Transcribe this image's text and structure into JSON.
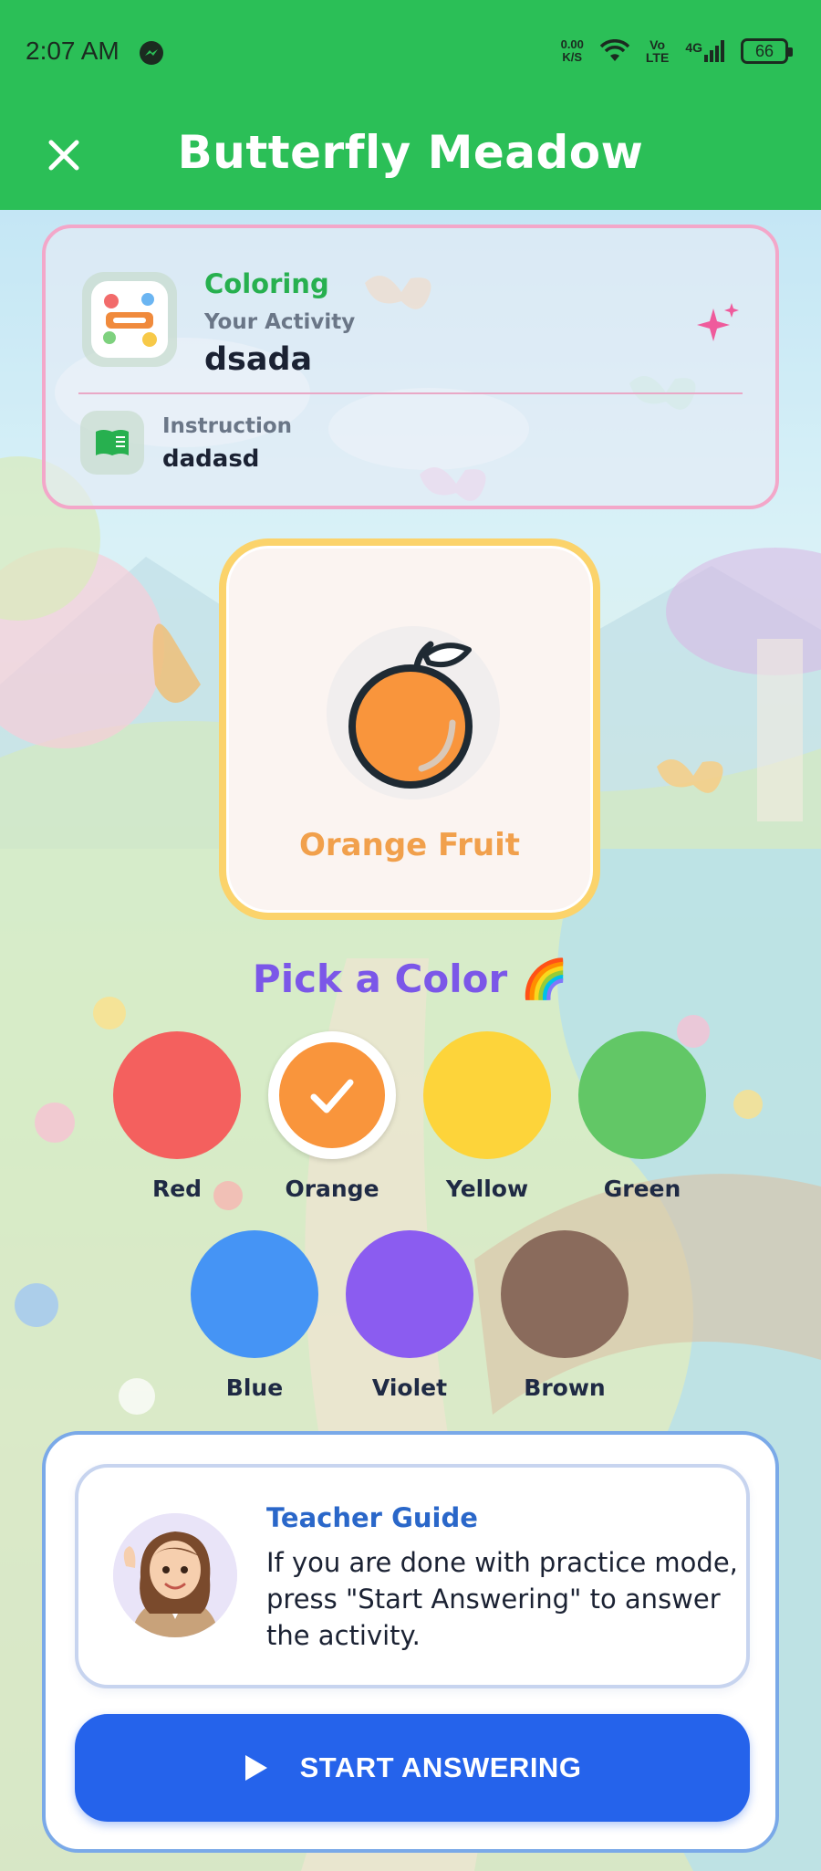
{
  "status_bar": {
    "time": "2:07 AM",
    "net_speed_value": "0.00",
    "net_speed_unit": "K/S",
    "volte_top": "Vo",
    "volte_bottom": "LTE",
    "network": "4G",
    "battery": "66"
  },
  "header": {
    "title": "Butterfly Meadow",
    "background_color": "#2bbf57"
  },
  "activity": {
    "type": "Coloring",
    "label": "Your Activity",
    "name": "dsada",
    "instruction_label": "Instruction",
    "instruction": "dadasd"
  },
  "object": {
    "name": "Orange Fruit"
  },
  "color_picker": {
    "title": "Pick a Color 🌈",
    "selected": "Orange",
    "colors": [
      {
        "name": "Red",
        "hex": "#f4605e"
      },
      {
        "name": "Orange",
        "hex": "#f9953c"
      },
      {
        "name": "Yellow",
        "hex": "#fdd43a"
      },
      {
        "name": "Green",
        "hex": "#62c766"
      },
      {
        "name": "Blue",
        "hex": "#4594f5"
      },
      {
        "name": "Violet",
        "hex": "#8b5cf0"
      },
      {
        "name": "Brown",
        "hex": "#8a6b5c"
      }
    ]
  },
  "teacher_guide": {
    "title": "Teacher Guide",
    "message": "If you are done with practice mode, press \"Start Answering\" to answer the activity."
  },
  "start_button": {
    "label": "START ANSWERING",
    "color": "#2563eb"
  }
}
